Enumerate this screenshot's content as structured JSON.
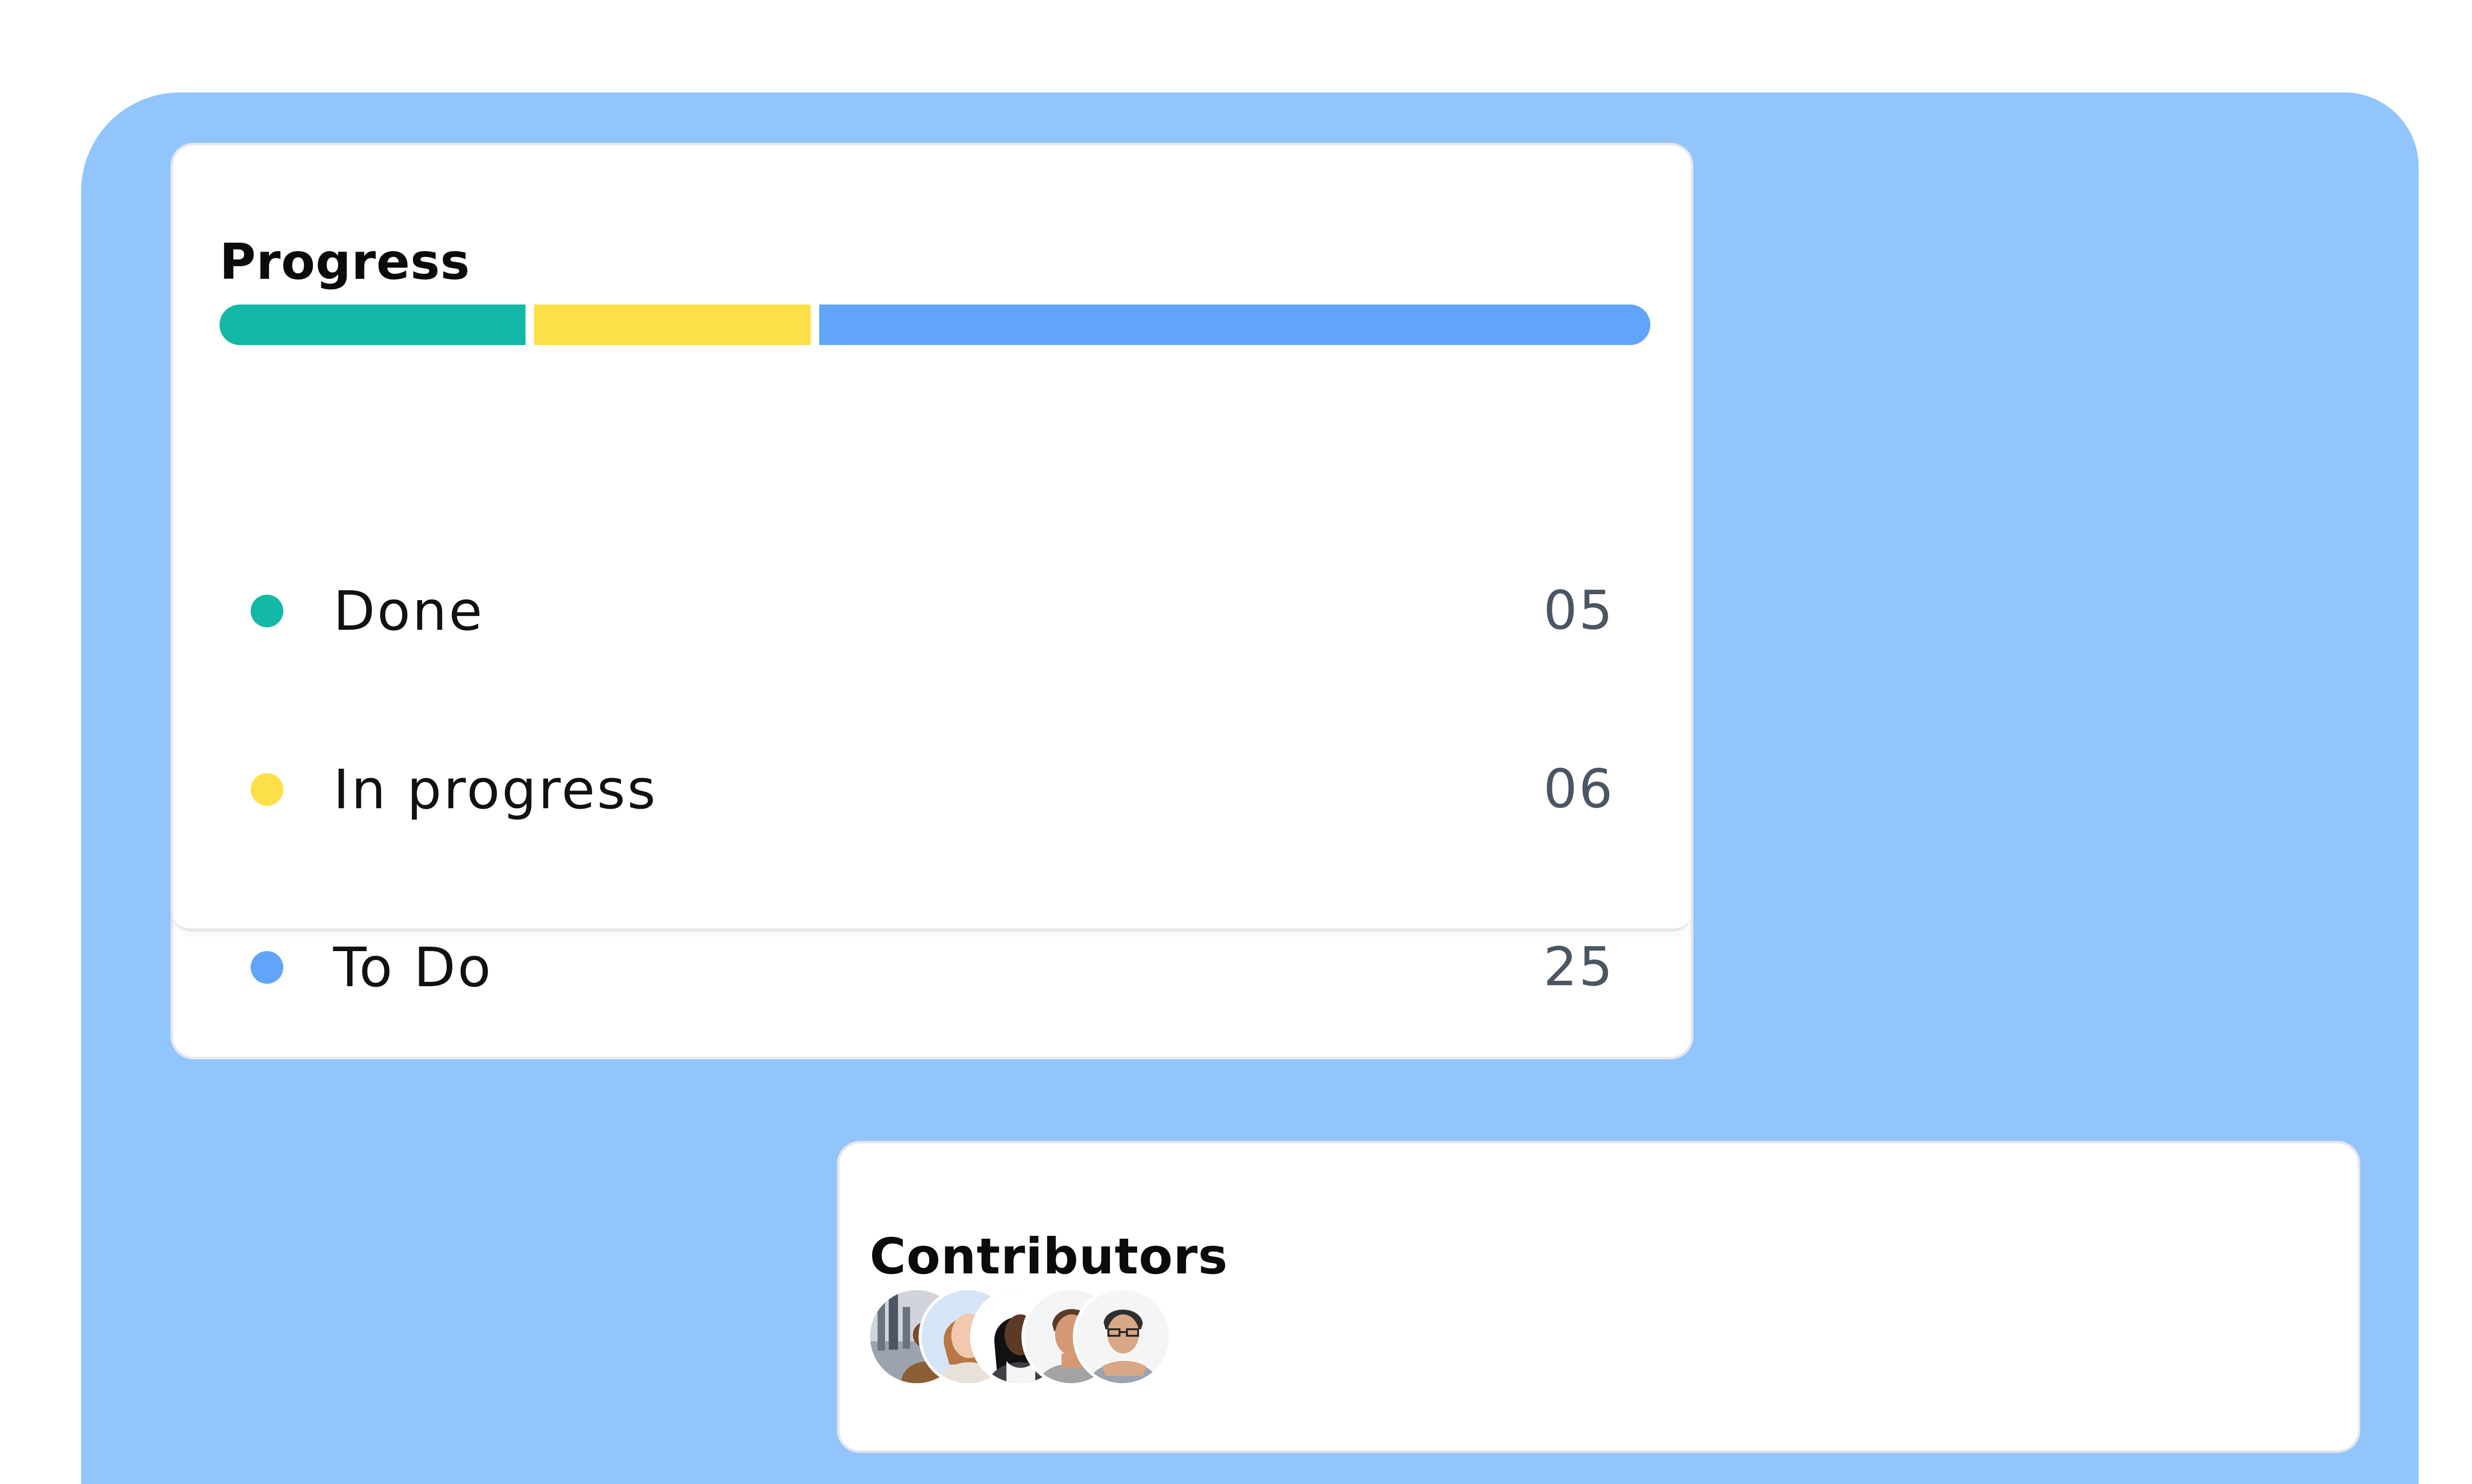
{
  "progress": {
    "title": "Progress",
    "bar": {
      "segments": [
        {
          "name": "Done",
          "value": 5,
          "color": "#14b8a6"
        },
        {
          "name": "In progress",
          "value": 6,
          "color": "#fde047"
        },
        {
          "name": "To Do",
          "value": 25,
          "color": "#60a5fa"
        }
      ]
    },
    "items": [
      {
        "label": "Done",
        "count": "05",
        "color": "#14b8a6"
      },
      {
        "label": "In progress",
        "count": "06",
        "color": "#fde047"
      },
      {
        "label": "To Do",
        "count": "25",
        "color": "#60a5fa"
      }
    ]
  },
  "contributors": {
    "title": "Contributors",
    "avatars": [
      {
        "icon": "avatar-photo-1"
      },
      {
        "icon": "avatar-photo-2"
      },
      {
        "icon": "avatar-photo-3"
      },
      {
        "icon": "avatar-photo-4"
      },
      {
        "icon": "avatar-photo-5"
      }
    ]
  },
  "colors": {
    "background_panel": "#93c5fd",
    "card_border": "#e5e7eb",
    "done": "#14b8a6",
    "in_progress": "#fde047",
    "todo": "#60a5fa"
  }
}
